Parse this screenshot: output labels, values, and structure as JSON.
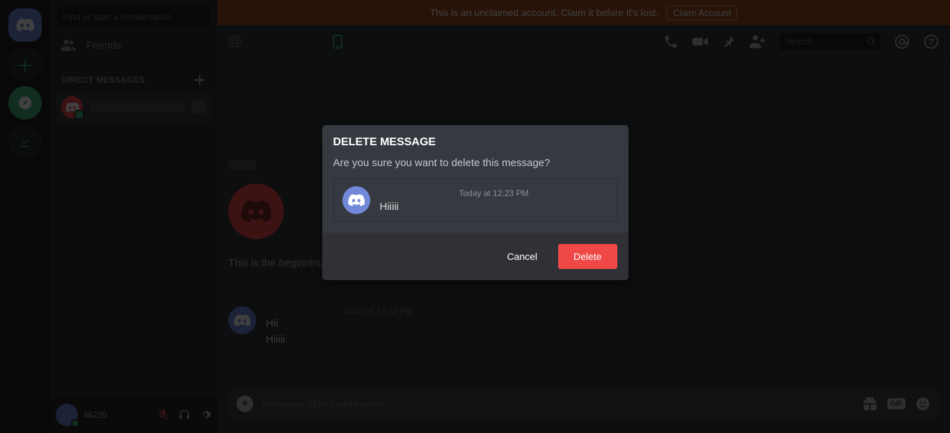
{
  "banner": {
    "text": "This is an unclaimed account. Claim it before it's lost.",
    "button": "Claim Account"
  },
  "sidebar": {
    "search_placeholder": "Find or start a conversation",
    "friends_label": "Friends",
    "dm_heading": "DIRECT MESSAGES"
  },
  "user": {
    "tag": "#6220"
  },
  "header": {
    "search_placeholder": "Search"
  },
  "chat": {
    "beginning_text": "This is the beginning",
    "msg_time": "Today at 12:22 PM",
    "messages": [
      "Hii",
      "Hiiiii"
    ],
    "input_placeholder": "Message @MahaMaverick",
    "gif_label": "GIF"
  },
  "modal": {
    "title": "DELETE MESSAGE",
    "subtitle": "Are you sure you want to delete this message?",
    "msg_time": "Today at 12:23 PM",
    "msg_body": "Hiiiii",
    "cancel": "Cancel",
    "delete": "Delete"
  }
}
